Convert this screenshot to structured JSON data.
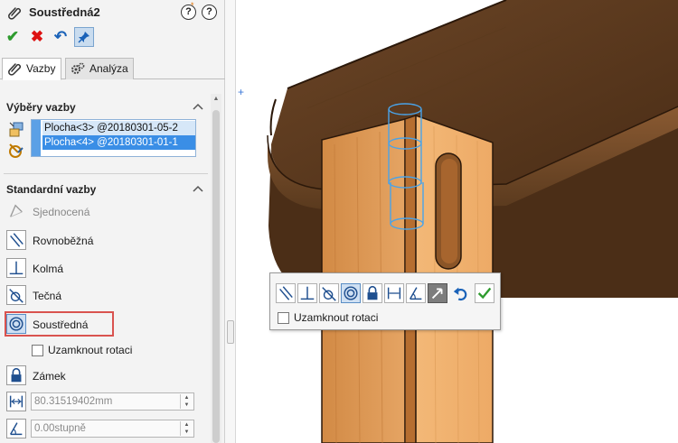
{
  "window": {
    "title": "Soustředná2"
  },
  "header": {
    "help_label": "?",
    "help_label_2": "?",
    "help_badge": "*"
  },
  "actions": {
    "ok": "✔",
    "cancel": "✖",
    "undo": "↶"
  },
  "tabs": [
    {
      "label": "Vazby",
      "active": true
    },
    {
      "label": "Analýza",
      "active": false
    }
  ],
  "selections": {
    "title": "Výběry vazby",
    "items": [
      "Plocha<3> @20180301-05-2",
      "Plocha<4> @20180301-01-1"
    ],
    "selected_index": 1
  },
  "standard_mates": {
    "title": "Standardní vazby",
    "items": [
      {
        "label": "Sjednocená",
        "enabled": false,
        "icon": "coincident-icon"
      },
      {
        "label": "Rovnoběžná",
        "enabled": true,
        "icon": "parallel-icon"
      },
      {
        "label": "Kolmá",
        "enabled": true,
        "icon": "perpendicular-icon"
      },
      {
        "label": "Tečná",
        "enabled": true,
        "icon": "tangent-icon"
      },
      {
        "label": "Soustředná",
        "enabled": true,
        "selected": true,
        "icon": "concentric-icon"
      }
    ],
    "lock_rotation_label": "Uzamknout rotaci",
    "lock_label": "Zámek",
    "distance_value": "80.31519402mm",
    "angle_value": "0.00stupně"
  },
  "context_toolbar": {
    "lock_rotation_label": "Uzamknout rotaci",
    "buttons": [
      "parallel-icon",
      "perpendicular-icon",
      "tangent-icon",
      "concentric-icon",
      "lock-icon",
      "distance-icon",
      "angle-icon",
      "flip-icon",
      "undo-icon",
      "ok-icon"
    ]
  },
  "colors": {
    "accent": "#3a8ee6",
    "highlight_frame": "#d9534f",
    "ok_green": "#2e9b2e",
    "cancel_red": "#dd1111",
    "wood_light": "#e9a55a",
    "wood_dark": "#5c3a1f",
    "preview_blue": "#4aa3e8"
  }
}
